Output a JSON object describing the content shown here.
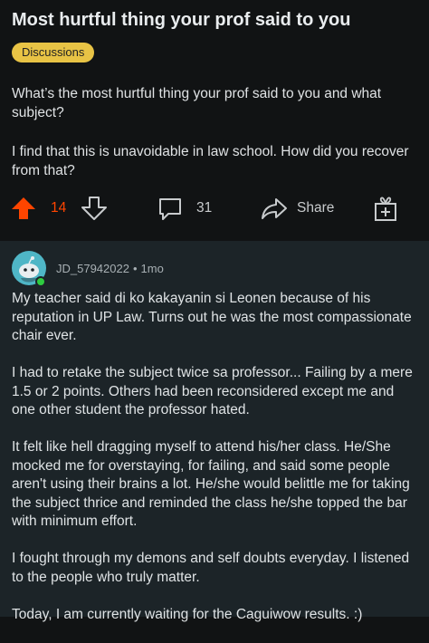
{
  "post": {
    "title": "Most hurtful thing your prof said to you",
    "flair": "Discussions",
    "body": [
      "What’s the most hurtful thing your prof said to you and what subject?",
      "I find that this is unavoidable in law school. How did you recover from that?"
    ],
    "actions": {
      "score": "14",
      "comments": "31",
      "share_label": "Share"
    }
  },
  "comment": {
    "username": "JD_57942022",
    "separator": "•",
    "age": "1mo",
    "paragraphs": [
      "My teacher said di ko kakayanin si Leonen because of his reputation in UP Law. Turns out he was the most compassionate chair ever.",
      "I had to retake the subject twice sa professor... Failing by a mere 1.5 or 2 points. Others had been reconsidered except me and one other student the professor hated.",
      "It felt like hell dragging myself to attend his/her class. He/She mocked me for overstaying, for failing, and said some people aren't using their brains a lot. He/she would belittle me for taking the subject thrice and reminded the class he/she topped the bar with minimum effort.",
      "I fought through my demons and self doubts everyday. I listened to the people who truly matter.",
      "Today, I am currently waiting for the Caguiwow results. :)"
    ]
  },
  "colors": {
    "background": "#111314",
    "comment_background": "#1c2428",
    "flair": "#e8c345",
    "upvote_active": "#ff4500",
    "avatar": "#4fb6c6",
    "online": "#2ecc40"
  },
  "icons": {
    "upvote": "arrow-up-icon",
    "downvote": "arrow-down-icon",
    "comment": "speech-bubble-icon",
    "share": "share-arrow-icon",
    "award": "gift-award-icon",
    "avatar": "snoo-avatar-icon"
  }
}
